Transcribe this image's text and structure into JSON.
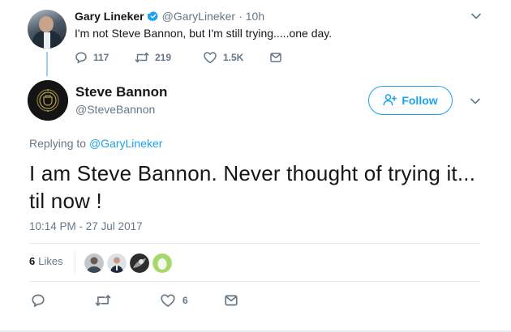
{
  "colors": {
    "accent": "#1da1f2",
    "text": "#14171a",
    "muted": "#657786",
    "thread": "#9cd0f2",
    "divider": "#e6ecf0"
  },
  "parent_tweet": {
    "author_name": "Gary Lineker",
    "handle": "@GaryLineker",
    "separator": "·",
    "time": "10h",
    "text": "I'm not Steve Bannon, but I'm still trying.....one day.",
    "verified_icon": "verified-badge-icon",
    "actions": {
      "reply_count": "117",
      "retweet_count": "219",
      "like_count": "1.5K"
    }
  },
  "main_tweet": {
    "author_name": "Steve Bannon",
    "handle": "@SteveBannon",
    "follow_label": "Follow",
    "replying_prefix": "Replying to",
    "replying_handle": "@GaryLineker",
    "text": "I am Steve Bannon. Never thought of trying it... til now !",
    "timestamp": "10:14 PM - 27 Jul 2017",
    "likes_count": "6",
    "likes_label": "Likes",
    "actions": {
      "like_count": "6"
    }
  }
}
